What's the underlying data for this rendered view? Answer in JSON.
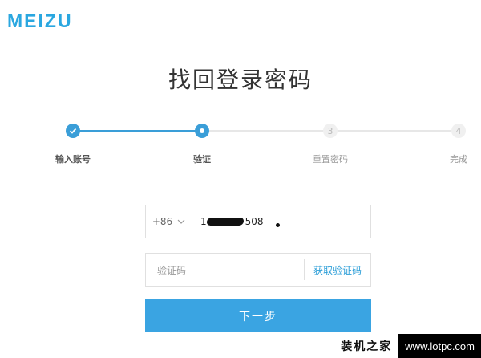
{
  "brand": {
    "logo": "MEIZU",
    "color": "#2aa7e0"
  },
  "page_title": "找回登录密码",
  "steps": [
    {
      "label": "输入账号",
      "state": "done",
      "icon": "check-icon"
    },
    {
      "label": "验证",
      "state": "active",
      "icon": "dot-icon"
    },
    {
      "label": "重置密码",
      "state": "todo",
      "number": "3"
    },
    {
      "label": "完成",
      "state": "todo",
      "number": "4"
    }
  ],
  "form": {
    "country_code": "+86",
    "phone_visible": "1",
    "phone_suffix": "508",
    "code_placeholder": "验证码",
    "get_code_label": "获取验证码",
    "next_label": "下一步"
  },
  "watermark": {
    "cn": "装机之家",
    "url": "www.lotpc.com"
  },
  "colors": {
    "accent": "#3aa4e2",
    "inactive": "#e7e7e7"
  }
}
